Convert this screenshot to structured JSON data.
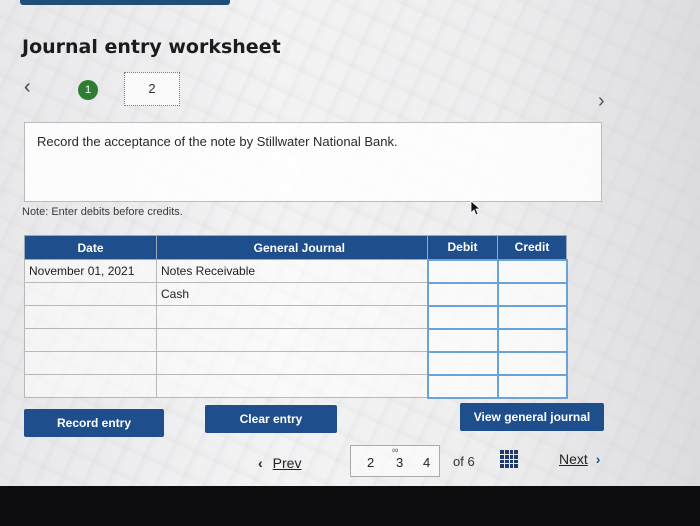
{
  "header": {
    "title": "Journal entry worksheet"
  },
  "stepper": {
    "prev_icon": "chevron-left",
    "next_icon": "chevron-right",
    "steps": [
      "1",
      "2"
    ],
    "active_step": "2"
  },
  "instruction": {
    "text": "Record the acceptance of the note by Stillwater National Bank."
  },
  "note": "Note: Enter debits before credits.",
  "table": {
    "headers": {
      "date": "Date",
      "general_journal": "General Journal",
      "debit": "Debit",
      "credit": "Credit"
    },
    "rows": [
      {
        "date": "November 01, 2021",
        "account": "Notes Receivable",
        "debit": "",
        "credit": ""
      },
      {
        "date": "",
        "account": "Cash",
        "debit": "",
        "credit": ""
      },
      {
        "date": "",
        "account": "",
        "debit": "",
        "credit": ""
      },
      {
        "date": "",
        "account": "",
        "debit": "",
        "credit": ""
      },
      {
        "date": "",
        "account": "",
        "debit": "",
        "credit": ""
      },
      {
        "date": "",
        "account": "",
        "debit": "",
        "credit": ""
      }
    ]
  },
  "buttons": {
    "record": "Record entry",
    "clear": "Clear entry",
    "view": "View general journal"
  },
  "pagination": {
    "prev_label": "Prev",
    "next_label": "Next",
    "pages": [
      "2",
      "3",
      "4"
    ],
    "current_page": "3",
    "of_label": "of 6"
  },
  "colors": {
    "brand": "#1f4e8c",
    "step_done": "#2e7d32",
    "input_border": "#6aa3d8"
  }
}
